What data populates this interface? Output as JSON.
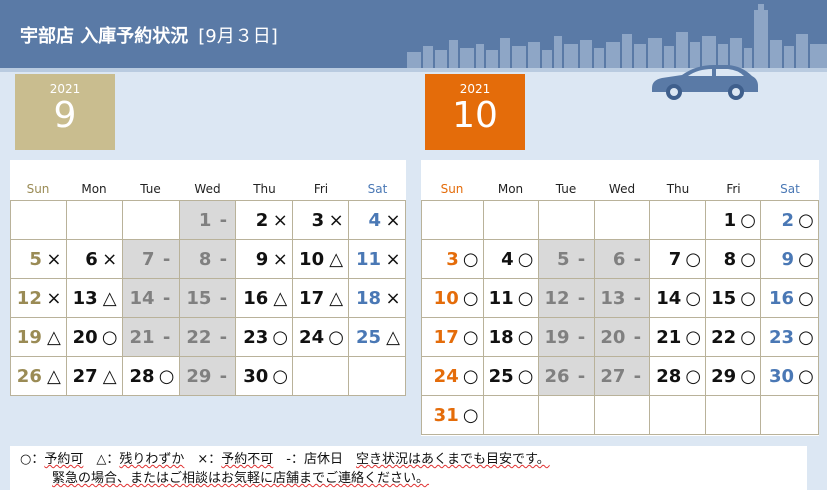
{
  "header": {
    "title": "宇部店 入庫予約状況",
    "date": "[9月３日]"
  },
  "months": {
    "sep": {
      "year": "2021",
      "month": "9"
    },
    "oct": {
      "year": "2021",
      "month": "10"
    }
  },
  "weekdays": [
    "Sun",
    "Mon",
    "Tue",
    "Wed",
    "Thu",
    "Fri",
    "Sat"
  ],
  "calendars": {
    "sep": {
      "rows": [
        [
          null,
          null,
          null,
          {
            "d": "1",
            "m": "-",
            "c": true
          },
          {
            "d": "2",
            "m": "×"
          },
          {
            "d": "3",
            "m": "×"
          },
          {
            "d": "4",
            "m": "×"
          }
        ],
        [
          {
            "d": "5",
            "m": "×"
          },
          {
            "d": "6",
            "m": "×"
          },
          {
            "d": "7",
            "m": "-",
            "c": true
          },
          {
            "d": "8",
            "m": "-",
            "c": true
          },
          {
            "d": "9",
            "m": "×"
          },
          {
            "d": "10",
            "m": "△"
          },
          {
            "d": "11",
            "m": "×"
          }
        ],
        [
          {
            "d": "12",
            "m": "×"
          },
          {
            "d": "13",
            "m": "△"
          },
          {
            "d": "14",
            "m": "-",
            "c": true
          },
          {
            "d": "15",
            "m": "-",
            "c": true
          },
          {
            "d": "16",
            "m": "△"
          },
          {
            "d": "17",
            "m": "△"
          },
          {
            "d": "18",
            "m": "×"
          }
        ],
        [
          {
            "d": "19",
            "m": "△"
          },
          {
            "d": "20",
            "m": "○"
          },
          {
            "d": "21",
            "m": "-",
            "c": true
          },
          {
            "d": "22",
            "m": "-",
            "c": true
          },
          {
            "d": "23",
            "m": "○"
          },
          {
            "d": "24",
            "m": "○"
          },
          {
            "d": "25",
            "m": "△"
          }
        ],
        [
          {
            "d": "26",
            "m": "△"
          },
          {
            "d": "27",
            "m": "△"
          },
          {
            "d": "28",
            "m": "○"
          },
          {
            "d": "29",
            "m": "-",
            "c": true
          },
          {
            "d": "30",
            "m": "○"
          },
          null,
          null
        ]
      ]
    },
    "oct": {
      "rows": [
        [
          null,
          null,
          null,
          null,
          null,
          {
            "d": "1",
            "m": "○"
          },
          {
            "d": "2",
            "m": "○"
          }
        ],
        [
          {
            "d": "3",
            "m": "○"
          },
          {
            "d": "4",
            "m": "○"
          },
          {
            "d": "5",
            "m": "-",
            "c": true
          },
          {
            "d": "6",
            "m": "-",
            "c": true
          },
          {
            "d": "7",
            "m": "○"
          },
          {
            "d": "8",
            "m": "○"
          },
          {
            "d": "9",
            "m": "○"
          }
        ],
        [
          {
            "d": "10",
            "m": "○"
          },
          {
            "d": "11",
            "m": "○"
          },
          {
            "d": "12",
            "m": "-",
            "c": true
          },
          {
            "d": "13",
            "m": "-",
            "c": true
          },
          {
            "d": "14",
            "m": "○"
          },
          {
            "d": "15",
            "m": "○"
          },
          {
            "d": "16",
            "m": "○"
          }
        ],
        [
          {
            "d": "17",
            "m": "○"
          },
          {
            "d": "18",
            "m": "○"
          },
          {
            "d": "19",
            "m": "-",
            "c": true
          },
          {
            "d": "20",
            "m": "-",
            "c": true
          },
          {
            "d": "21",
            "m": "○"
          },
          {
            "d": "22",
            "m": "○"
          },
          {
            "d": "23",
            "m": "○"
          }
        ],
        [
          {
            "d": "24",
            "m": "○"
          },
          {
            "d": "25",
            "m": "○"
          },
          {
            "d": "26",
            "m": "-",
            "c": true
          },
          {
            "d": "27",
            "m": "-",
            "c": true
          },
          {
            "d": "28",
            "m": "○"
          },
          {
            "d": "29",
            "m": "○"
          },
          {
            "d": "30",
            "m": "○"
          }
        ],
        [
          {
            "d": "31",
            "m": "○"
          },
          null,
          null,
          null,
          null,
          null,
          null
        ]
      ]
    }
  },
  "legend": {
    "line1_a": "○：",
    "line1_b": "予約可",
    "line1_c": "　△：",
    "line1_d": "残りわずか",
    "line1_e": "　×：",
    "line1_f": "予約不可",
    "line1_g": "　-：店休日　",
    "line1_h": "空き状況はあくまでも目安です。",
    "line2": "緊急の場合、またはご相談はお気軽に店舗までご連絡ください。"
  },
  "colors": {
    "header": "#5a7aa6",
    "sep_month": "#c9bd8f",
    "oct_month": "#e46c0a",
    "saturday": "#4a78b5",
    "closed": "#d9d9d9"
  },
  "icons": [
    "skyline-illustration",
    "car-icon"
  ]
}
